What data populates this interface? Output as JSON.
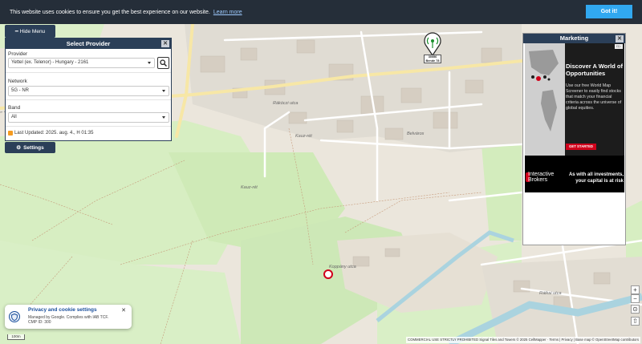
{
  "cookie": {
    "message": "This website uses cookies to ensure you get the best experience on our website.",
    "learn_more": "Learn more",
    "accept": "Got it!"
  },
  "menu": {
    "hide_label": "Hide Menu",
    "settings_label": "Settings"
  },
  "provider_panel": {
    "title": "Select Provider",
    "close": "✕",
    "provider_label": "Provider",
    "provider_value": "Yettel (ex. Telenor) - Hungary - 2161",
    "network_label": "Network",
    "network_value": "5G - NR",
    "band_label": "Band",
    "band_value": "All",
    "last_updated": "Last Updated: 2025. aug. 4., H 01:35"
  },
  "tower": {
    "line1": "30556",
    "line2": "Bende 78"
  },
  "map_labels": {
    "kauz_ret_1": "Kauz-rét",
    "kauz_ret_2": "Kauz-rét",
    "belvaros": "Belváros",
    "rakoczi": "Rákóczi utca",
    "koppany": "Koppány utca",
    "ratkai": "Rátkai utca"
  },
  "marketing": {
    "title": "Marketing",
    "close": "✕",
    "ad_title": "Discover A World of Opportunities",
    "ad_body": "Use our free World Map Screener to easily find stocks that match your financial criteria across the universe of global equities.",
    "ad_cta": "GET STARTED",
    "ad_brand_line1": "Interactive",
    "ad_brand_line2": "Brokers",
    "ad_risk": "As with all investments, your capital is at risk",
    "ad_choices": "D▷"
  },
  "privacy": {
    "title": "Privacy and cookie settings",
    "line1": "Managed by Google. Complies with IAB TCF.",
    "line2": "CMP ID: 300",
    "close": "✕"
  },
  "controls": {
    "zoom_in": "+",
    "zoom_out": "−",
    "locate": "⊙",
    "layers": "⇧"
  },
  "scale": "100m",
  "attribution": "COMMERCIAL USE STRICTLY PROHIBITED Signal Tiles and Towers © 2025 CellMapper · Terms | Privacy | Base map © OpenStreetMap contributors",
  "colors": {
    "dark_navy": "#2b3f58",
    "cookie_bg": "#252e39",
    "cookie_btn": "#31a8f0",
    "ad_red": "#d0021b"
  }
}
